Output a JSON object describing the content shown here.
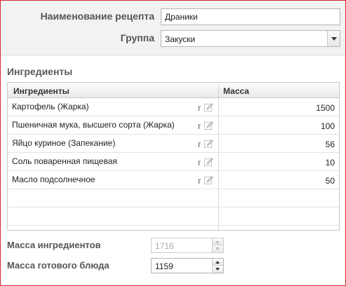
{
  "recipe": {
    "name_label": "Наименование рецепта",
    "name_value": "Драники",
    "group_label": "Группа",
    "group_value": "Закуски"
  },
  "ingredients": {
    "section_title": "Ингредиенты",
    "columns": {
      "name": "Ингредиенты",
      "mass": "Масса"
    },
    "rows": [
      {
        "name": "Картофель (Жарка)",
        "unit": "г",
        "mass": "1500"
      },
      {
        "name": "Пшеничная мука, высшего сорта (Жарка)",
        "unit": "г",
        "mass": "100"
      },
      {
        "name": "Яйцо куриное (Запекание)",
        "unit": "г",
        "mass": "56"
      },
      {
        "name": "Соль поваренная пищевая",
        "unit": "г",
        "mass": "10"
      },
      {
        "name": "Масло подсолнечное",
        "unit": "г",
        "mass": "50"
      }
    ]
  },
  "totals": {
    "ingredients_mass_label": "Масса  ингредиентов",
    "ingredients_mass_value": "1716",
    "dish_mass_label": "Масса готового блюда",
    "dish_mass_value": "1159"
  },
  "colors": {
    "frame_border": "#d9262b",
    "header_bg": "#f2f2f2",
    "label_text": "#555555"
  }
}
